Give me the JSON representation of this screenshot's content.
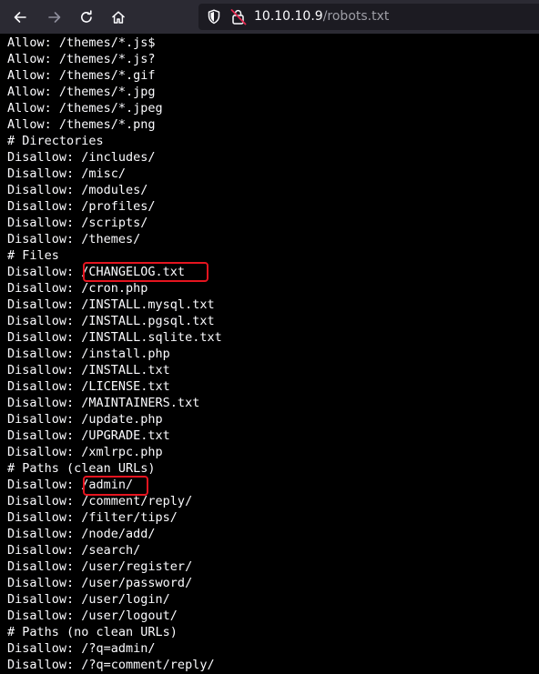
{
  "browser": {
    "back_icon": "arrow-left-icon",
    "forward_icon": "arrow-right-icon",
    "reload_icon": "reload-icon",
    "home_icon": "home-icon",
    "shield_icon": "shield-icon",
    "lock_icon": "insecure-lock-icon",
    "url_host": "10.10.10.9",
    "url_path": "/robots.txt"
  },
  "document": {
    "lines": [
      "Allow: /themes/*.js$",
      "Allow: /themes/*.js?",
      "Allow: /themes/*.gif",
      "Allow: /themes/*.jpg",
      "Allow: /themes/*.jpeg",
      "Allow: /themes/*.png",
      "# Directories",
      "Disallow: /includes/",
      "Disallow: /misc/",
      "Disallow: /modules/",
      "Disallow: /profiles/",
      "Disallow: /scripts/",
      "Disallow: /themes/",
      "# Files",
      "Disallow: /CHANGELOG.txt",
      "Disallow: /cron.php",
      "Disallow: /INSTALL.mysql.txt",
      "Disallow: /INSTALL.pgsql.txt",
      "Disallow: /INSTALL.sqlite.txt",
      "Disallow: /install.php",
      "Disallow: /INSTALL.txt",
      "Disallow: /LICENSE.txt",
      "Disallow: /MAINTAINERS.txt",
      "Disallow: /update.php",
      "Disallow: /UPGRADE.txt",
      "Disallow: /xmlrpc.php",
      "# Paths (clean URLs)",
      "Disallow: /admin/",
      "Disallow: /comment/reply/",
      "Disallow: /filter/tips/",
      "Disallow: /node/add/",
      "Disallow: /search/",
      "Disallow: /user/register/",
      "Disallow: /user/password/",
      "Disallow: /user/login/",
      "Disallow: /user/logout/",
      "# Paths (no clean URLs)",
      "Disallow: /?q=admin/",
      "Disallow: /?q=comment/reply/"
    ]
  },
  "annotations": {
    "color": "#e5141f",
    "highlighted": [
      "/CHANGELOG.txt",
      "/admin/"
    ]
  }
}
